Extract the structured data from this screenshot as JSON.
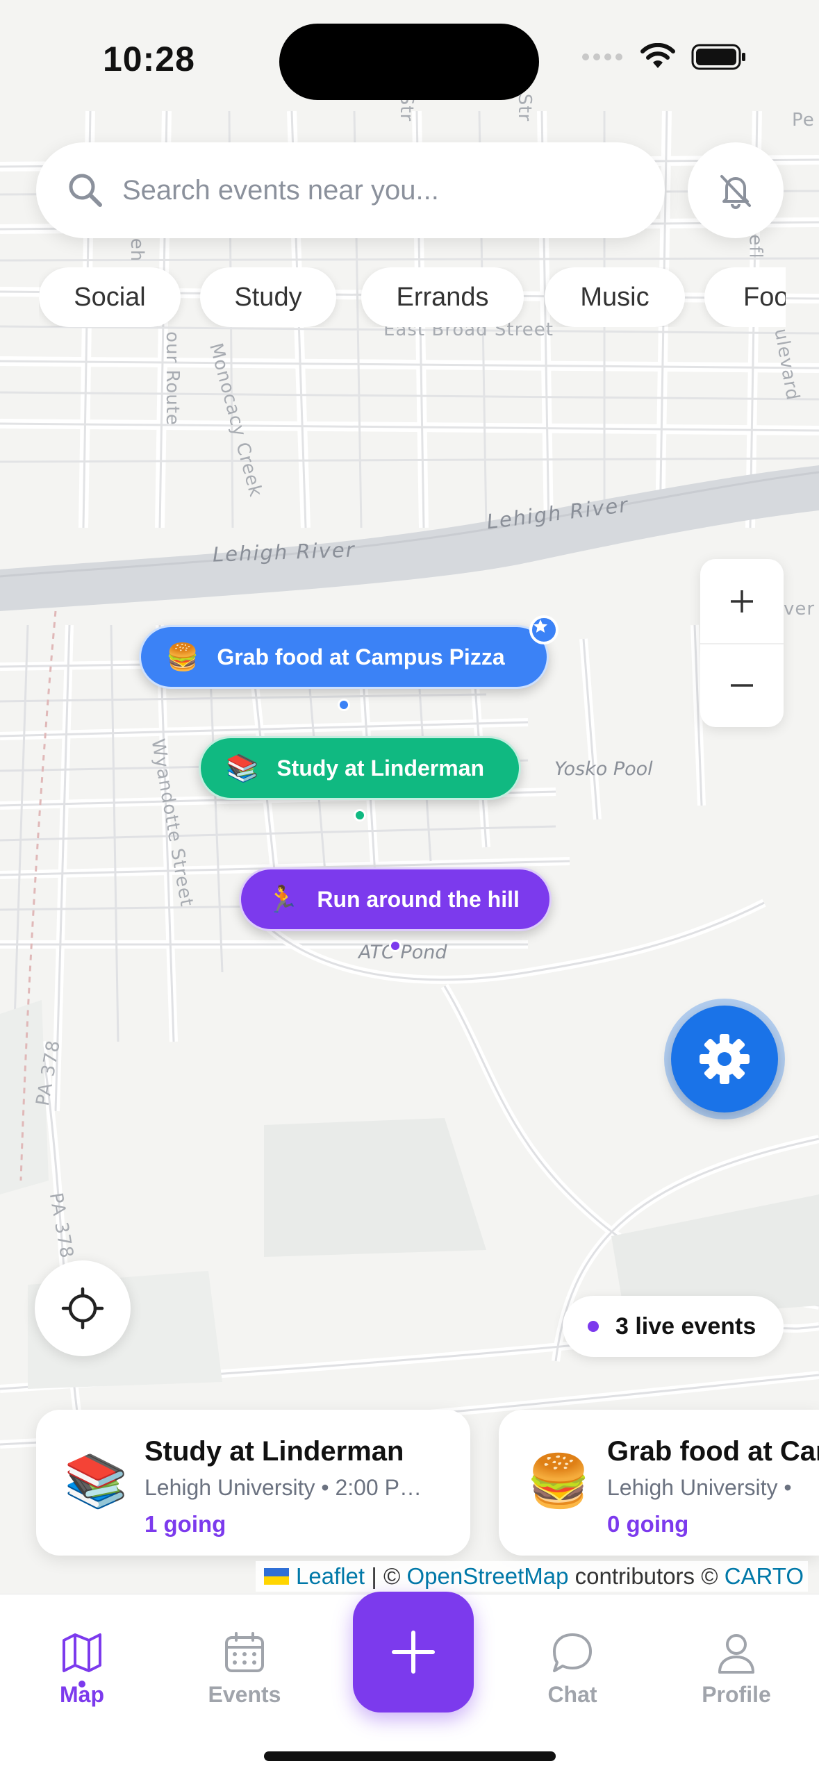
{
  "status_bar": {
    "time": "10:28"
  },
  "search": {
    "placeholder": "Search events near you..."
  },
  "chips": [
    "Social",
    "Study",
    "Errands",
    "Music",
    "Food"
  ],
  "map_labels": {
    "river_1": "Lehigh River",
    "river_2": "Lehigh River",
    "east_broad": "East Broad Street",
    "wyandotte": "Wyandotte Street",
    "monocacy": "Monocacy Creek",
    "our_route": "our Route",
    "yosko": "Yosko Pool",
    "atc_pond": "ATC Pond",
    "pa378_1": "PA 378",
    "pa378_2": "PA 378",
    "boulevard": "ulevard",
    "str_1": "Str",
    "str_2": "Str",
    "pe": "Pe",
    "eh": "eh",
    "efl": "efl",
    "ver": "ver"
  },
  "pins": [
    {
      "emoji": "🍔",
      "label": "Grab food at Campus Pizza",
      "color": "#3b82f6"
    },
    {
      "emoji": "📚",
      "label": "Study at Linderman",
      "color": "#10b981"
    },
    {
      "emoji": "🏃",
      "label": "Run around the hill",
      "color": "#7c3aed"
    }
  ],
  "live_badge": {
    "text": "3 live events"
  },
  "cards": [
    {
      "emoji": "📚",
      "title": "Study at Linderman",
      "subtitle": "Lehigh University • 2:00 P…",
      "going": "1 going"
    },
    {
      "emoji": "🍔",
      "title": "Grab food at Campus Pizza",
      "subtitle": "Lehigh University •",
      "going": "0 going"
    }
  ],
  "attribution": {
    "leaflet": "Leaflet",
    "sep": " | © ",
    "osm": "OpenStreetMap",
    "contrib": " contributors © ",
    "carto": "CARTO"
  },
  "tabs": {
    "map": "Map",
    "events": "Events",
    "chat": "Chat",
    "profile": "Profile"
  },
  "colors": {
    "accent": "#7c3aed",
    "blue": "#3b82f6",
    "green": "#10b981",
    "gear": "#1a73e8"
  }
}
